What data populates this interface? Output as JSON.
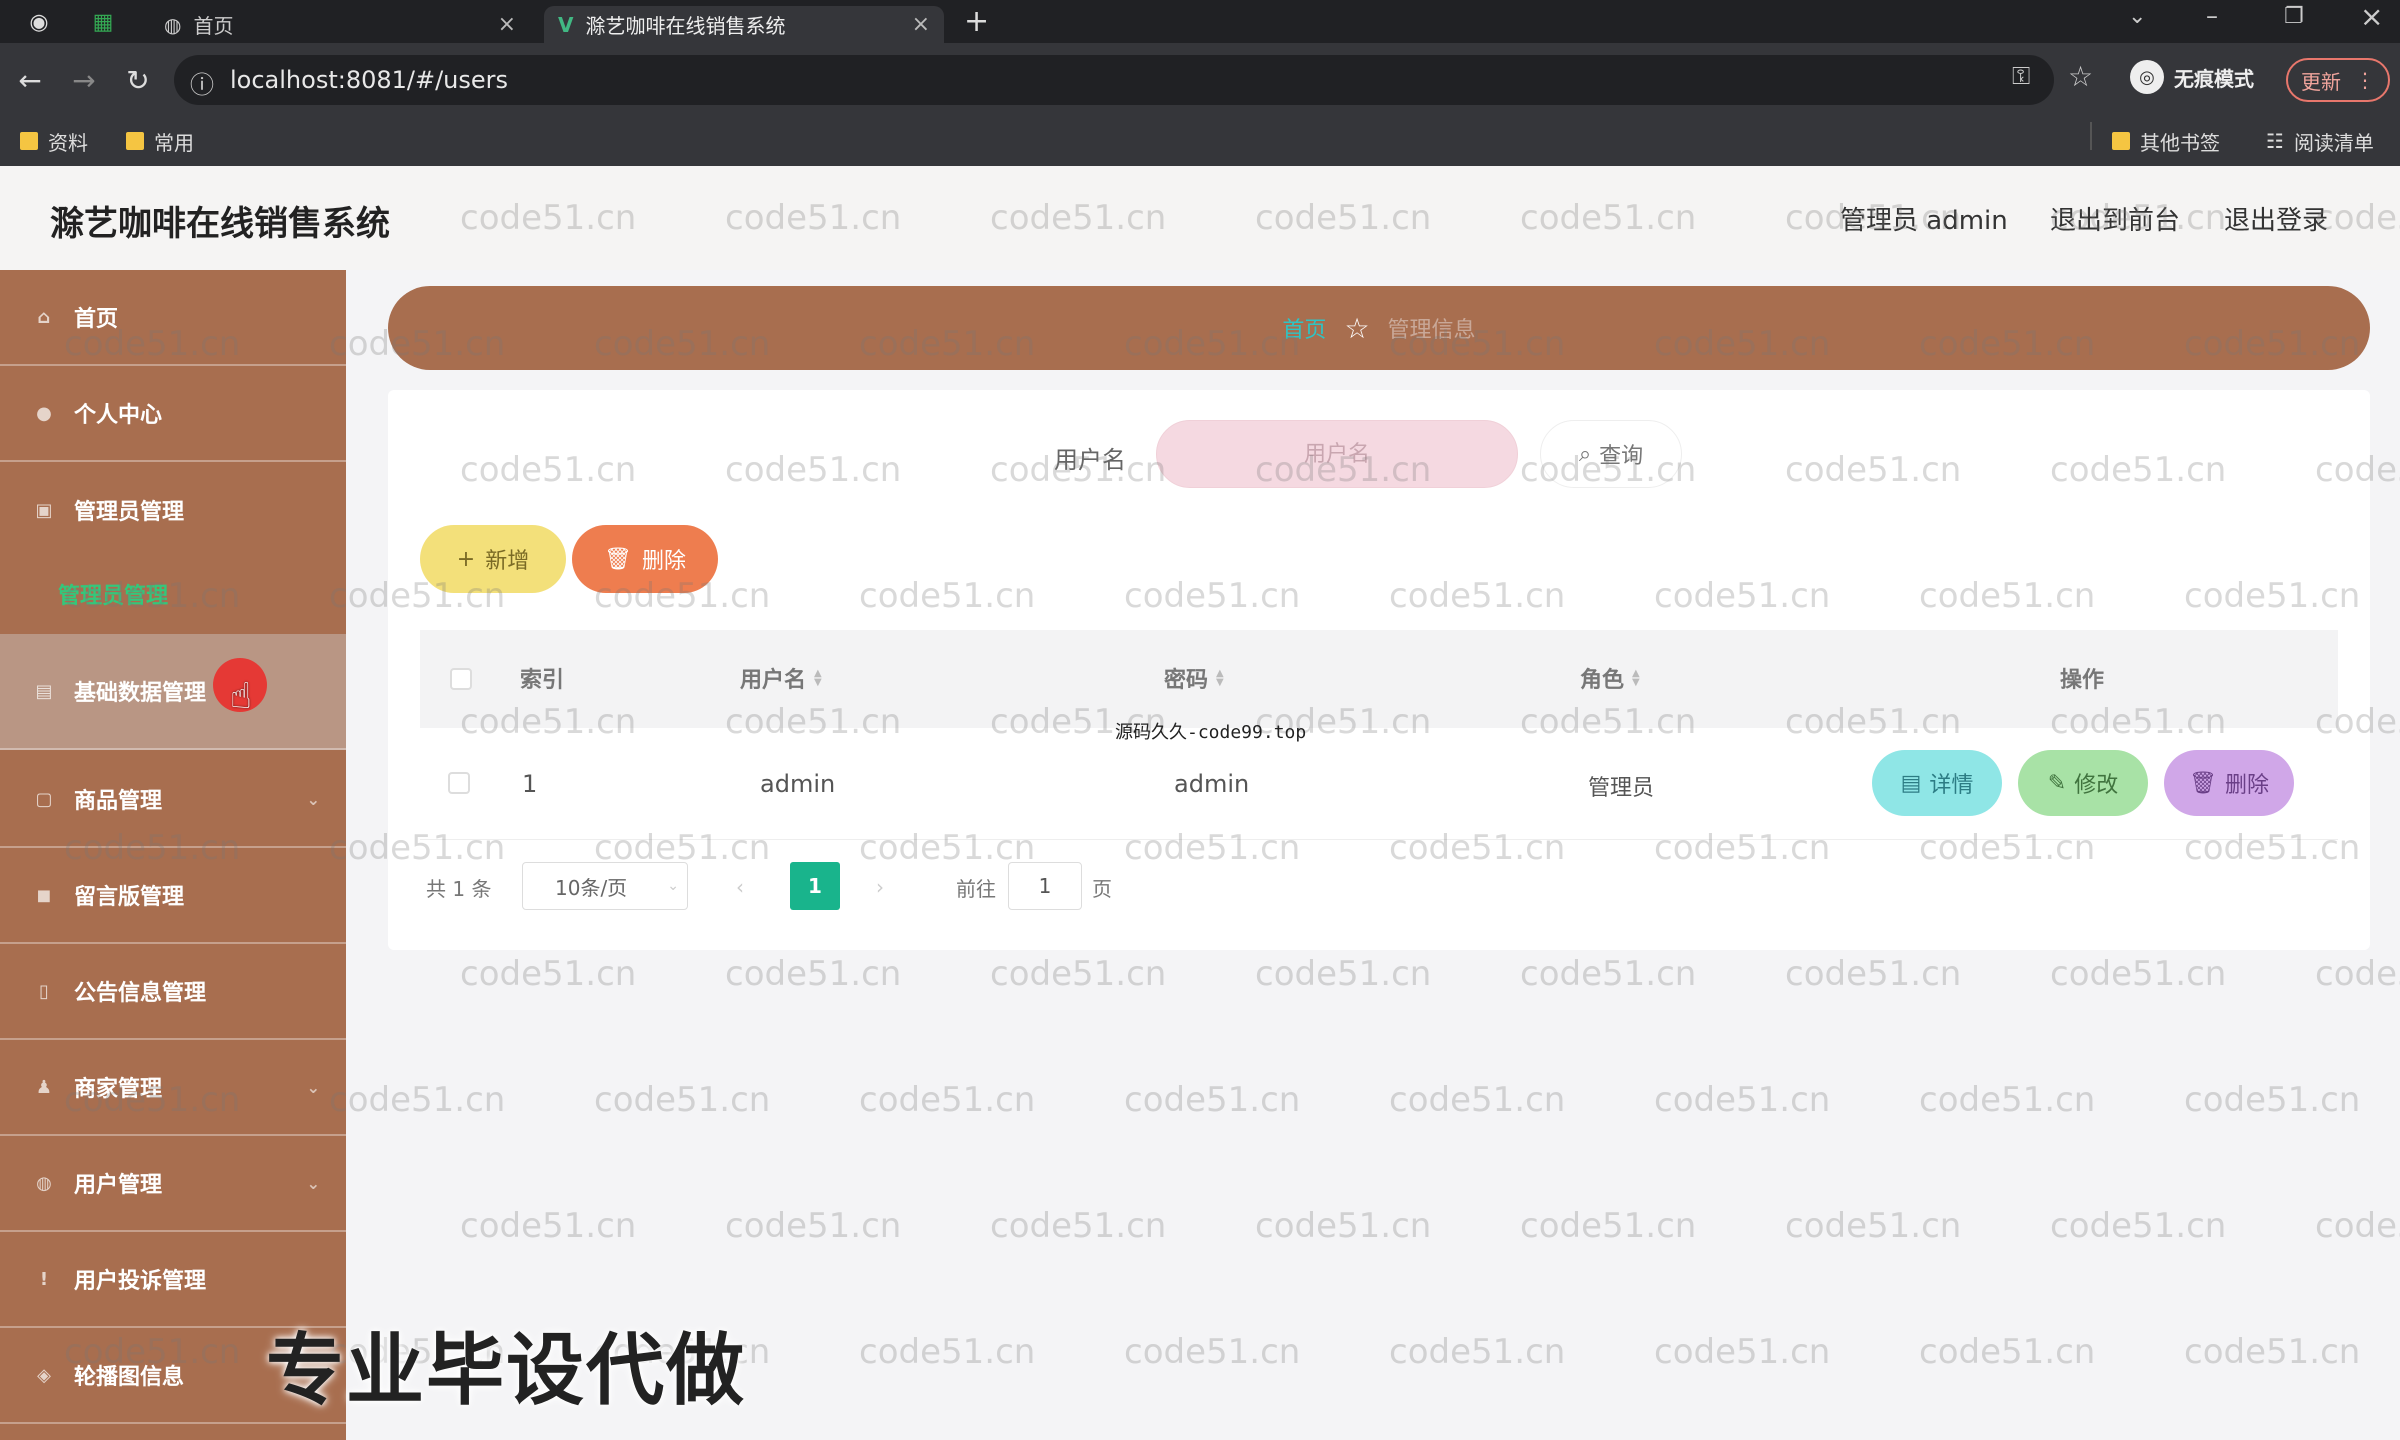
{
  "browser": {
    "tabs": [
      {
        "label": "首页"
      },
      {
        "label": "滁艺咖啡在线销售系统"
      }
    ],
    "url": "localhost:8081/#/users",
    "incognito_label": "无痕模式",
    "update_label": "更新",
    "bookmarks": [
      "资料",
      "常用"
    ],
    "bookmarks_right": [
      "其他书签",
      "阅读清单"
    ]
  },
  "header": {
    "title": "滁艺咖啡在线销售系统",
    "user": "管理员 admin",
    "to_front": "退出到前台",
    "logout": "退出登录"
  },
  "sidebar": {
    "items": [
      {
        "label": "首页",
        "icon": "home-icon"
      },
      {
        "label": "个人中心",
        "icon": "user-icon"
      },
      {
        "label": "管理员管理",
        "icon": "admin-icon"
      },
      {
        "label": "管理员管理",
        "sub": true
      },
      {
        "label": "基础数据管理",
        "icon": "data-icon"
      },
      {
        "label": "商品管理",
        "icon": "goods-icon"
      },
      {
        "label": "留言版管理",
        "icon": "message-icon"
      },
      {
        "label": "公告信息管理",
        "icon": "notice-icon"
      },
      {
        "label": "商家管理",
        "icon": "merchant-icon"
      },
      {
        "label": "用户管理",
        "icon": "users-icon"
      },
      {
        "label": "用户投诉管理",
        "icon": "complaint-icon"
      },
      {
        "label": "轮播图信息",
        "icon": "carousel-icon"
      }
    ]
  },
  "breadcrumb": {
    "home": "首页",
    "current": "管理信息"
  },
  "search": {
    "label": "用户名",
    "placeholder": "用户名",
    "button": "查询"
  },
  "actions": {
    "add": "新增",
    "delete": "删除"
  },
  "table": {
    "headers": {
      "index": "索引",
      "username": "用户名",
      "password": "密码",
      "role": "角色",
      "ops": "操作"
    },
    "rows": [
      {
        "index": "1",
        "username": "admin",
        "password": "admin",
        "role": "管理员"
      }
    ],
    "op_buttons": {
      "detail": "详情",
      "edit": "修改",
      "delete": "删除"
    }
  },
  "pagination": {
    "total": "共 1 条",
    "page_size": "10条/页",
    "current_page": "1",
    "goto_label": "前往",
    "goto_value": "1",
    "page_suffix": "页"
  },
  "overlays": {
    "watermark": "code51.cn",
    "center_mark": "源码久久-code99.top",
    "promo": "专业毕设代做"
  },
  "colors": {
    "sidebar": "#a86e4f",
    "accent_green": "#19b48c",
    "add": "#f3e07a",
    "delete": "#ee7d4f",
    "detail": "#8fe6e6",
    "edit": "#a8e2a6",
    "op_delete": "#d0a7e8"
  }
}
